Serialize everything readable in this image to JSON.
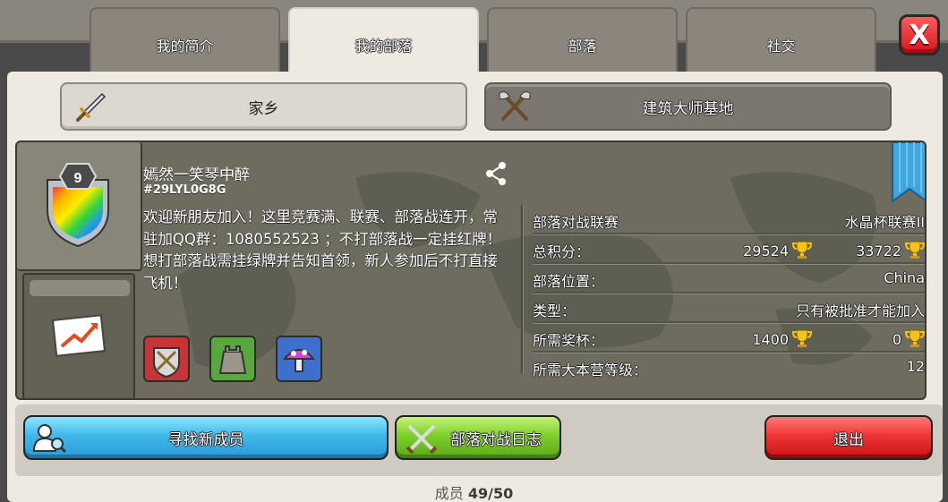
{
  "tabs": [
    {
      "label": "我的简介",
      "active": false
    },
    {
      "label": "我的部落",
      "active": true
    },
    {
      "label": "部落",
      "active": false
    },
    {
      "label": "社交",
      "active": false
    }
  ],
  "close_icon": "close-icon",
  "subtabs": {
    "home": {
      "label": "家乡",
      "icon": "sword-icon"
    },
    "builder": {
      "label": "建筑大师基地",
      "icon": "crossed-axes-icon"
    }
  },
  "clan": {
    "level": "9",
    "name": "嫣然一笑琴中醉",
    "tag": "#29LYL0G8G",
    "description": "欢迎新朋友加入！这里竞赛满、联赛、部落战连开，常驻加QQ群：1080552523 ；不打部落战一定挂红牌！想打部落战需挂绿牌并告知首领，新人参加后不打直接飞机！"
  },
  "stats": {
    "war_league": {
      "label": "部落对战联赛",
      "value": "水晶杯联赛II"
    },
    "total_points": {
      "label": "总积分：",
      "value1": "29524",
      "value2": "33722"
    },
    "location": {
      "label": "部落位置：",
      "value": "China"
    },
    "type": {
      "label": "类型：",
      "value": "只有被批准才能加入"
    },
    "required_trophies": {
      "label": "所需奖杯：",
      "value1": "1400",
      "value2": "0"
    },
    "required_th": {
      "label": "所需大本营等级：",
      "value": "12"
    }
  },
  "buttons": {
    "find_members": "寻找新成员",
    "war_log": "部落对战日志",
    "leave": "退出"
  },
  "members": {
    "label": "成员",
    "count": "49/50"
  },
  "colors": {
    "accent_blue": "#40b8ea",
    "accent_green": "#7ecf2c",
    "accent_red": "#f03434",
    "gold": "#f5c21a"
  }
}
